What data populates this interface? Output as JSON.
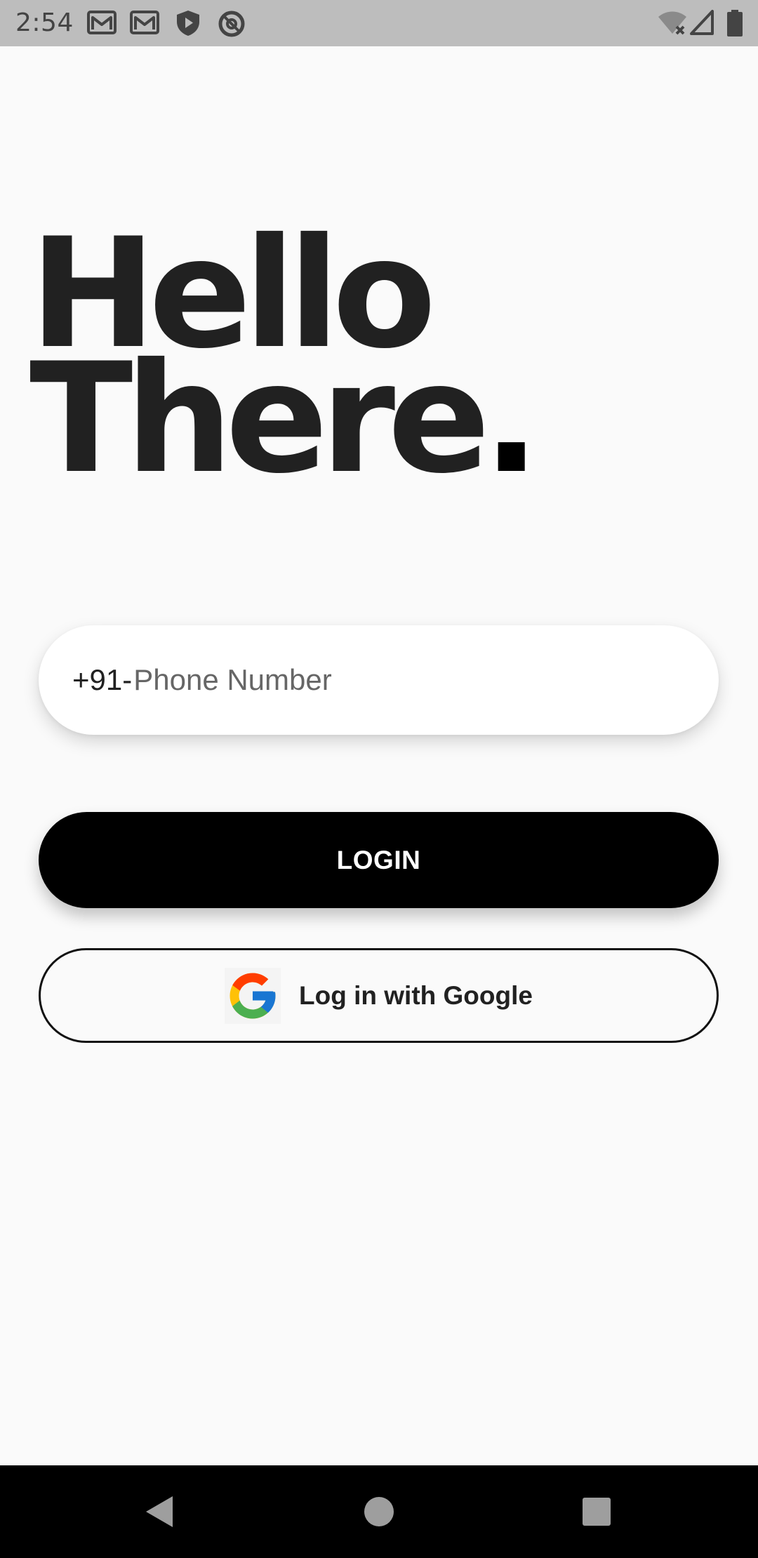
{
  "status_bar": {
    "time": "2:54",
    "icons": [
      "gmail-icon",
      "gmail-icon",
      "shield-play-icon",
      "at-sign-icon",
      "wifi-off-icon",
      "signal-icon",
      "battery-icon"
    ]
  },
  "hero": {
    "line1": "Hello",
    "line2": "There",
    "dot": "."
  },
  "phone_field": {
    "prefix": "+91-",
    "placeholder": "Phone Number",
    "value": ""
  },
  "login_button": {
    "label": "LOGIN"
  },
  "google_button": {
    "label": "Log in with Google",
    "icon": "google-logo-icon"
  },
  "nav_bar": {
    "buttons": [
      "back-icon",
      "home-icon",
      "recents-icon"
    ]
  },
  "colors": {
    "background": "#fafafa",
    "status_bar": "#bdbdbd",
    "text": "#212121",
    "primary_button": "#000000",
    "button_text": "#ffffff"
  }
}
